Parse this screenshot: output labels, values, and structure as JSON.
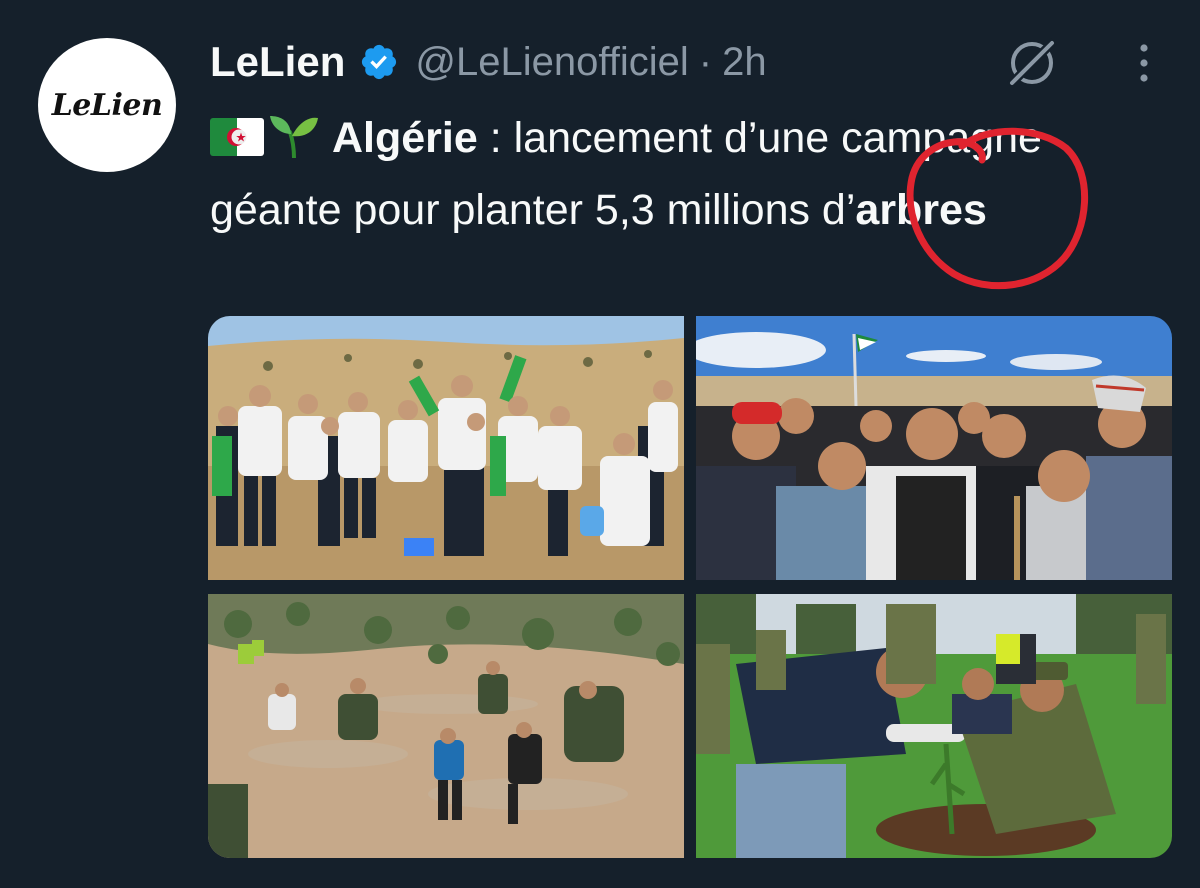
{
  "tweet": {
    "avatar_text": "LeLien",
    "name": "LeLien",
    "handle": "@LeLienofficiel",
    "separator": "·",
    "time": "2h",
    "text_word_1": "Algérie",
    "text_part_2": " : lancement d’une campagne géante pour planter 5,3 millions d’",
    "text_word_2": "arbres"
  },
  "icons": {
    "verified": "verified-badge-icon",
    "grok": "grok-icon",
    "more": "more-vertical-icon",
    "flag": "algeria-flag-emoji",
    "sprout": "seedling-emoji"
  },
  "colors": {
    "background": "#15202b",
    "text": "#f7f9f9",
    "secondary_text": "#8b98a5",
    "verified": "#1d9bf0",
    "annotation": "#e0242f"
  },
  "media": {
    "count": 4,
    "photos": [
      "photo-group-with-trees",
      "photo-crowd-selfie",
      "photo-people-planting-hillside",
      "photo-soldiers-planting-tree"
    ]
  }
}
